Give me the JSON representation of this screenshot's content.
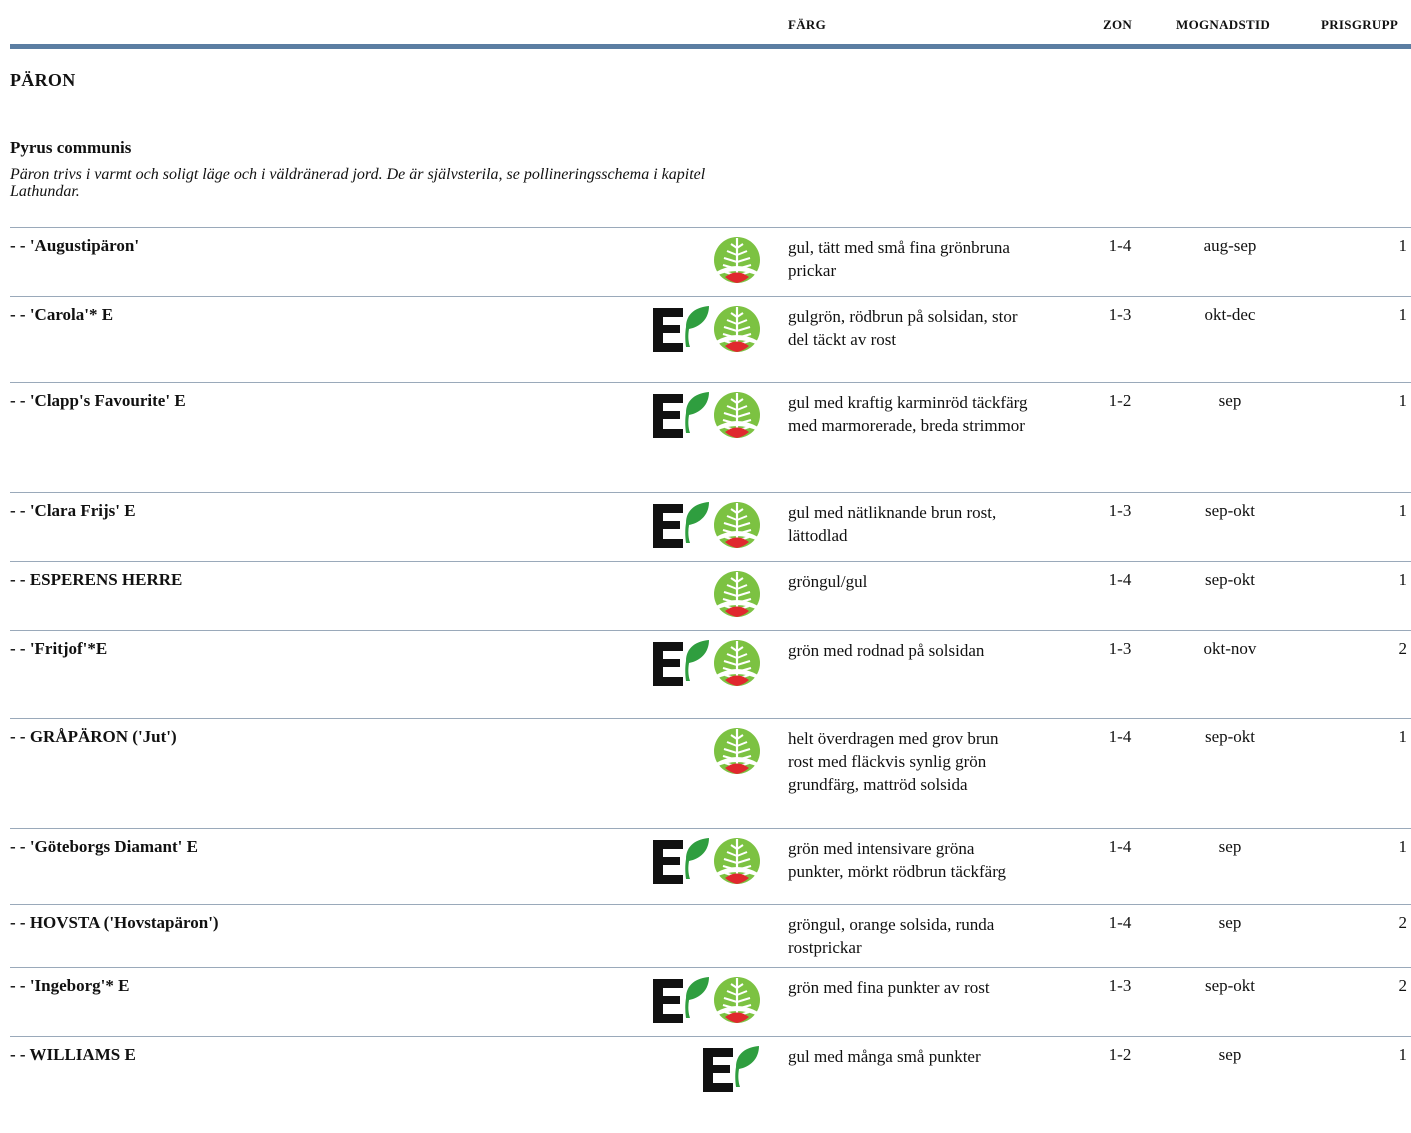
{
  "columns": {
    "color": "FÄRG",
    "zone": "ZON",
    "ripening": "MOGNADSTID",
    "price_group": "PRISGRUPP"
  },
  "section_title": "PÄRON",
  "species": {
    "name": "Pyrus communis",
    "description": "Päron trivs i varmt och soligt läge och i väldränerad jord. De är självsterila, se pollineringsschema i kapitel Lathundar."
  },
  "colors": {
    "rule": "#5b7ea2",
    "tree_green": "#7cc242",
    "tree_red": "#e0282e",
    "e_black": "#111111",
    "leaf_green": "#2f9e3f"
  },
  "icons": {
    "e_mark": "e-leaf-icon",
    "tree_mark": "tree-leaf-icon"
  },
  "varieties": [
    {
      "name": "- - 'Augustipäron'",
      "e_mark": false,
      "tree_mark": true,
      "color": "gul, tätt med små fina grönbruna prickar",
      "zone": "1-4",
      "ripening": "aug-sep",
      "price_group": "1"
    },
    {
      "name": "- - 'Carola'* E",
      "e_mark": true,
      "tree_mark": true,
      "color": "gulgrön, rödbrun på solsidan, stor del täckt av rost",
      "zone": "1-3",
      "ripening": "okt-dec",
      "price_group": "1"
    },
    {
      "name": "- - 'Clapp's Favourite' E",
      "e_mark": true,
      "tree_mark": true,
      "color": "gul med kraftig karminröd täckfärg med marmorerade, breda strimmor",
      "zone": "1-2",
      "ripening": "sep",
      "price_group": "1"
    },
    {
      "name": "- - 'Clara Frijs' E",
      "e_mark": true,
      "tree_mark": true,
      "color": "gul med nätliknande brun rost, lättodlad",
      "zone": "1-3",
      "ripening": "sep-okt",
      "price_group": "1"
    },
    {
      "name": "- - ESPERENS HERRE",
      "e_mark": false,
      "tree_mark": true,
      "color": "gröngul/gul",
      "zone": "1-4",
      "ripening": "sep-okt",
      "price_group": "1"
    },
    {
      "name": "- - 'Fritjof'*E",
      "e_mark": true,
      "tree_mark": true,
      "color": "grön med rodnad på solsidan",
      "zone": "1-3",
      "ripening": "okt-nov",
      "price_group": "2"
    },
    {
      "name": "- - GRÅPÄRON ('Jut')",
      "e_mark": false,
      "tree_mark": true,
      "color": "helt överdragen med grov brun rost med fläckvis synlig grön grundfärg, mattröd solsida",
      "zone": "1-4",
      "ripening": "sep-okt",
      "price_group": "1"
    },
    {
      "name": "- - 'Göteborgs Diamant' E",
      "e_mark": true,
      "tree_mark": true,
      "color": "grön med intensivare gröna punkter, mörkt rödbrun täckfärg",
      "zone": "1-4",
      "ripening": "sep",
      "price_group": "1"
    },
    {
      "name": "- - HOVSTA ('Hovstapäron')",
      "e_mark": false,
      "tree_mark": false,
      "color": "gröngul, orange solsida, runda rostprickar",
      "zone": "1-4",
      "ripening": "sep",
      "price_group": "2"
    },
    {
      "name": "- - 'Ingeborg'* E",
      "e_mark": true,
      "tree_mark": true,
      "color": "grön med fina punkter av rost",
      "zone": "1-3",
      "ripening": "sep-okt",
      "price_group": "2"
    },
    {
      "name": "- - WILLIAMS E",
      "e_mark": true,
      "tree_mark": false,
      "color": "gul med många små punkter",
      "zone": "1-2",
      "ripening": "sep",
      "price_group": "1"
    }
  ]
}
